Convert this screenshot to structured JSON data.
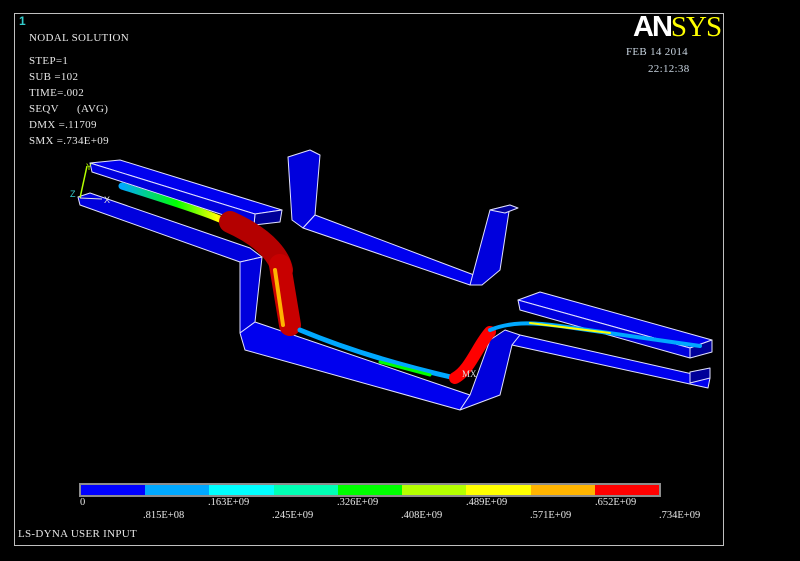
{
  "window_number": "1",
  "header": {
    "title": "NODAL SOLUTION",
    "lines": [
      "STEP=1",
      "SUB =102",
      "TIME=.002",
      "SEQV      (AVG)",
      "DMX =.11709",
      "SMX =.734E+09"
    ]
  },
  "logo": {
    "part1": "AN",
    "part2": "SYS"
  },
  "date": "FEB 14 2014",
  "time": "22:12:38",
  "triad": {
    "y": "Y",
    "z": "Z",
    "x": "X"
  },
  "max_marker": "MX",
  "legend": {
    "colors": [
      "#0000ff",
      "#00a8ff",
      "#00ffff",
      "#00ffb4",
      "#00ff00",
      "#b4ff00",
      "#ffff00",
      "#ffb400",
      "#ff0000"
    ],
    "labels_top": [
      "0",
      ".163E+09",
      ".326E+09",
      ".489E+09",
      ".652E+09"
    ],
    "labels_bottom": [
      ".815E+08",
      ".245E+09",
      ".408E+09",
      ".571E+09",
      ".734E+09"
    ]
  },
  "footer": "LS-DYNA USER INPUT"
}
